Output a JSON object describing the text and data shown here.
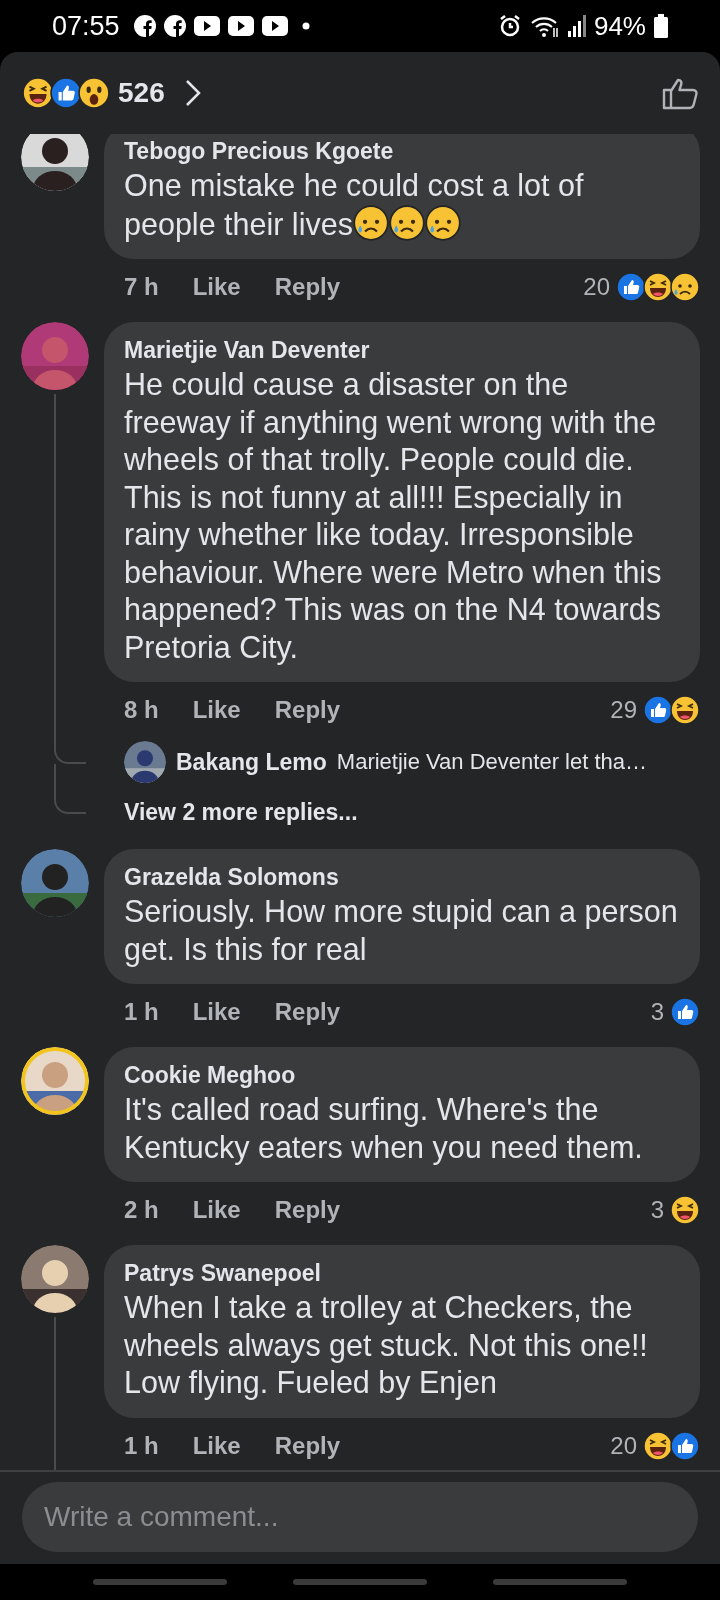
{
  "status_bar": {
    "time": "07:55",
    "notifications": [
      {
        "kind": "facebook"
      },
      {
        "kind": "facebook"
      },
      {
        "kind": "youtube"
      },
      {
        "kind": "youtube"
      },
      {
        "kind": "youtube"
      }
    ],
    "battery": "94%"
  },
  "header": {
    "reactions": [
      {
        "kind": "haha"
      },
      {
        "kind": "like"
      },
      {
        "kind": "wow"
      }
    ],
    "count": "526"
  },
  "comments": [
    {
      "author": "Tebogo Precious Kgoete",
      "text": "One mistake he could cost a lot of people their lives",
      "emojis": [
        {
          "kind": "sad"
        },
        {
          "kind": "sad"
        },
        {
          "kind": "sad"
        }
      ],
      "time": "7 h",
      "like": "Like",
      "reply": "Reply",
      "count": "20",
      "reactions": [
        {
          "kind": "like"
        },
        {
          "kind": "haha"
        },
        {
          "kind": "sad"
        }
      ]
    },
    {
      "author": "Marietjie Van Deventer",
      "text": "He could cause a disaster on the freeway if anything went wrong with the wheels of that trolly. People could die. This is not funny at all!!! Especially in rainy whether like today. Irresponsible behaviour. Where were Metro when this happened? This was on the N4 towards Pretoria City.",
      "time": "8 h",
      "like": "Like",
      "reply": "Reply",
      "count": "29",
      "reactions": [
        {
          "kind": "like"
        },
        {
          "kind": "haha"
        }
      ],
      "replies": [
        {
          "author": "Bakang Lemo",
          "text": "Marietjie Van Deventer let tha…"
        }
      ],
      "more_replies": "View 2 more replies..."
    },
    {
      "author": "Grazelda Solomons",
      "text": "Seriously. How more stupid can a person get. Is this for real",
      "time": "1 h",
      "like": "Like",
      "reply": "Reply",
      "count": "3",
      "reactions": [
        {
          "kind": "like"
        }
      ]
    },
    {
      "author": "Cookie Meghoo",
      "text": "It's called road surfing. Where's the Kentucky eaters when you need them.",
      "time": "2 h",
      "like": "Like",
      "reply": "Reply",
      "count": "3",
      "reactions": [
        {
          "kind": "haha"
        }
      ]
    },
    {
      "author": "Patrys Swanepoel",
      "text": "When I take a trolley at Checkers, the wheels always get stuck. Not this one!! Low flying. Fueled by Enjen",
      "time": "1 h",
      "like": "Like",
      "reply": "Reply",
      "count": "20",
      "reactions": [
        {
          "kind": "haha"
        },
        {
          "kind": "like"
        }
      ],
      "thread_continues": true
    }
  ],
  "composer": {
    "placeholder": "Write a comment..."
  }
}
